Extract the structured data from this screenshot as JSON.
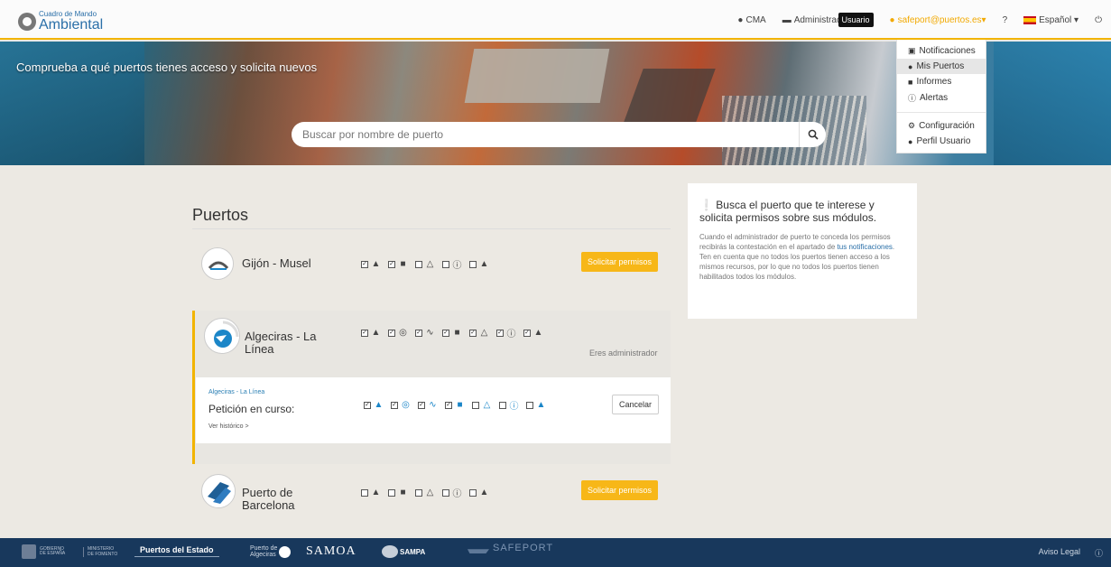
{
  "topnav": {
    "brand_small": "Cuadro de Mando",
    "brand_big": "Ambiental",
    "cma": "CMA",
    "admin": "Administrad",
    "user_tooltip": "Usuario",
    "email": "safeport@puertos.es▾",
    "help": "?",
    "language": "Español ▾",
    "power_icon": "⏻"
  },
  "dropdown": {
    "items": [
      {
        "icon": "notification-icon",
        "label": "Notificaciones"
      },
      {
        "icon": "user-icon",
        "label": "Mis Puertos"
      },
      {
        "icon": "report-icon",
        "label": "Informes"
      },
      {
        "icon": "alert-icon",
        "label": "Alertas"
      },
      {
        "icon": "gear-icon",
        "label": "Configuración"
      },
      {
        "icon": "profile-icon",
        "label": "Perfil Usuario"
      }
    ]
  },
  "hero": {
    "title": "Comprueba a qué puertos tienes acceso y solicita nuevos",
    "search_placeholder": "Buscar por nombre de puerto"
  },
  "ports_title": "Puertos",
  "ports": [
    {
      "name": "Gijón - Musel",
      "button": "Solicitar permisos"
    },
    {
      "name": "Algeciras - La Línea",
      "note": "Eres administrador"
    },
    {
      "name": "Puerto de Barcelona",
      "button": "Solicitar permisos"
    }
  ],
  "request": {
    "port": "Algeciras - La Línea",
    "title": "Petición en curso:",
    "history": "Ver histórico >",
    "cancel": "Cancelar"
  },
  "info": {
    "title": "Busca el puerto que te interese y solicita permisos sobre sus módulos.",
    "text_before": "Cuando el administrador de puerto te conceda los permisos recibirás la contestación en el apartado de ",
    "link": "tus notificaciones",
    "text_after": ". Ten en cuenta que no todos los puertos tienen acceso a los mismos recursos, por lo que no todos los puertos tienen habilitados todos los módulos."
  },
  "footer": {
    "gob1": "GOBIERNO",
    "gob2": "DE ESPAÑA",
    "min1": "MINISTERIO",
    "min2": "DE FOMENTO",
    "pe": "Puertos del Estado",
    "alg1": "Puerto de",
    "alg2": "Algeciras",
    "samoa": "SAMOA",
    "sampa": "SAMPA",
    "safeport": "SAFEPORT",
    "legal": "Aviso Legal",
    "info_icon": "ⓘ"
  }
}
